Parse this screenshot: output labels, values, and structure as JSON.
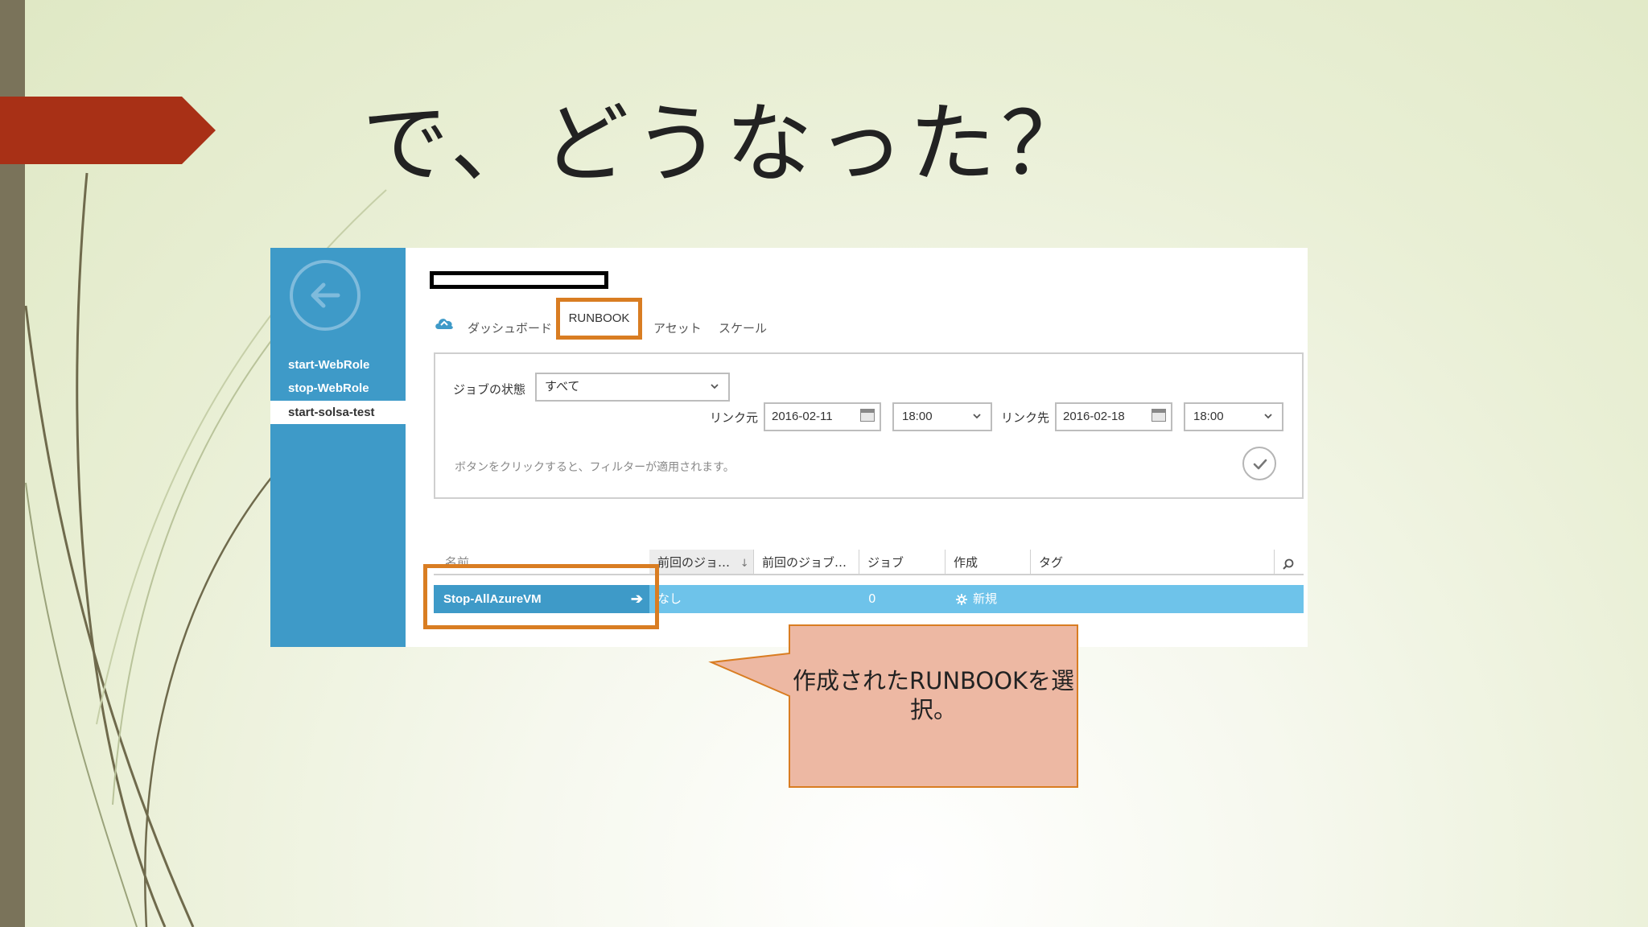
{
  "slide": {
    "title": "で、どうなった？"
  },
  "sidebar": {
    "items": [
      {
        "label": "start-WebRole"
      },
      {
        "label": "stop-WebRole"
      },
      {
        "label": "start-solsa-test"
      }
    ]
  },
  "tabs": {
    "dashboard": "ダッシュボード",
    "runbook": "RUNBOOK",
    "assets": "アセット",
    "scale": "スケール"
  },
  "filter": {
    "job_status_label": "ジョブの状態",
    "job_status_value": "すべて",
    "link_from_label": "リンク元",
    "link_from_date": "2016-02-11",
    "link_from_time": "18:00",
    "link_to_label": "リンク先",
    "link_to_date": "2016-02-18",
    "link_to_time": "18:00",
    "hint": "ボタンをクリックすると、フィルターが適用されます。"
  },
  "table": {
    "columns": [
      "名前",
      "前回のジョ…",
      "前回のジョブ…",
      "ジョブ",
      "作成",
      "タグ"
    ],
    "rows": [
      {
        "name": "Stop-AllAzureVM",
        "last_job": "なし",
        "jobs": "0",
        "created": "新規"
      }
    ]
  },
  "callout": {
    "text": "作成されたRUNBOOKを選択。"
  },
  "colors": {
    "accent_orange": "#d97d22",
    "azure_blue": "#3e9ac8",
    "row_highlight": "#6ec3ea",
    "callout_fill": "#edb8a3",
    "title_arrow": "#a83016"
  }
}
